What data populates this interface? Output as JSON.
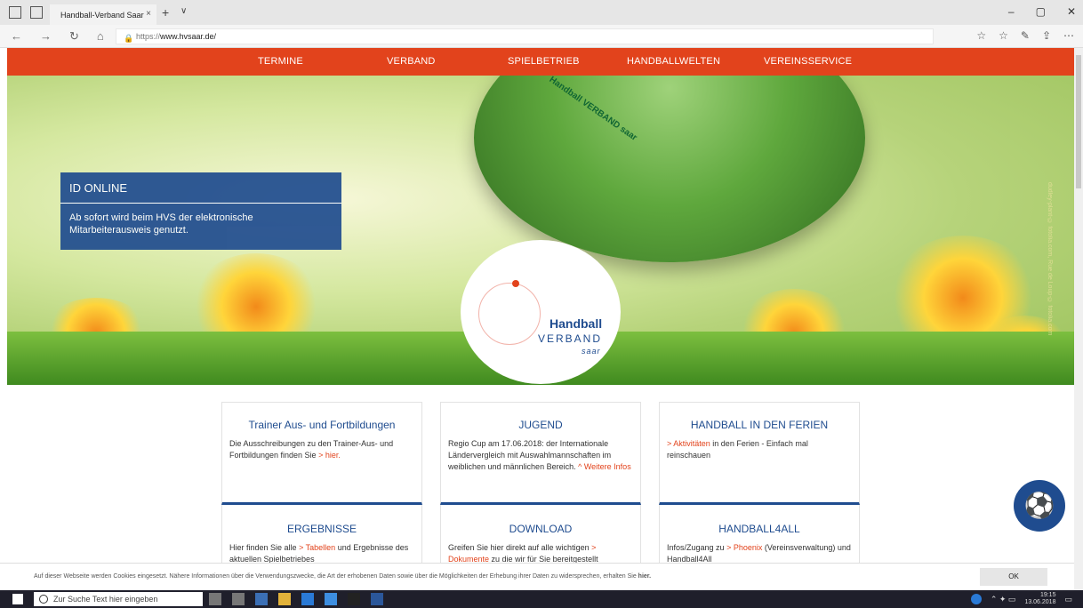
{
  "browser": {
    "tab_title": "Handball-Verband Saar",
    "tab_close": "×",
    "new_tab": "+",
    "tab_menu": "∨",
    "url_prefix": "https://",
    "url_domain": "www.hvsaar.de/",
    "win_controls": [
      "–",
      "▢",
      "✕"
    ],
    "nav_icons": [
      "←",
      "→",
      "↻",
      "⌂"
    ],
    "right_icons": [
      "☆",
      "☆",
      "✎",
      "⇪",
      "⋯"
    ]
  },
  "site": {
    "nav": [
      "TERMINE",
      "VERBAND",
      "SPIELBETRIEB",
      "HANDBALLWELTEN",
      "VEREINSSERVICE"
    ],
    "hero": {
      "info_title": "ID ONLINE",
      "info_text": "Ab sofort wird beim HVS der elektronische Mitarbeiterausweis genutzt.",
      "logo_line1": "Handball",
      "logo_line2": "VERBAND",
      "logo_line3": "saar",
      "ball_text": "Handball VERBAND saar",
      "credit": "dudley-plant-© fotolia.com, Rue de Loup-© fotolia.com"
    },
    "cards": [
      {
        "title": "Trainer Aus- und Fortbildungen",
        "text": "Die Ausschreibungen zu den Trainer-Aus- und Fortbildungen finden Sie",
        "link": "> hier."
      },
      {
        "title": "JUGEND",
        "text": "Regio Cup am 17.06.2018: der Internationale Ländervergleich mit Auswahlmannschaften im weiblichen und männlichen Bereich.",
        "link": "^ Weitere Infos"
      },
      {
        "title": "HANDBALL IN DEN FERIEN",
        "link": "> Aktivitäten",
        "text": "in den Ferien - Einfach mal reinschauen"
      }
    ],
    "cards2": [
      {
        "title": "ERGEBNISSE",
        "text_pre": "Hier finden Sie alle",
        "link": "> Tabellen",
        "text_post": "und Ergebnisse des aktuellen Spielbetriebes"
      },
      {
        "title": "DOWNLOAD",
        "text_pre": "Greifen Sie hier direkt auf alle wichtigen",
        "link": "> Dokumente",
        "text_post": "zu die wir für Sie bereitgestellt"
      },
      {
        "title": "HANDBALL4ALL",
        "text_pre": "Infos/Zugang zu",
        "link": "> Phoenix",
        "text_post": "(Vereinsverwaltung) und Handball4All"
      }
    ],
    "cookie": {
      "text": "Auf dieser Webseite werden Cookies eingesetzt. Nähere Informationen über die Verwendungszwecke, die Art der erhobenen Daten sowie über die Möglichkeiten der Erhebung ihrer Daten zu widersprechen, erhalten Sie",
      "link": "hier.",
      "button": "OK"
    }
  },
  "taskbar": {
    "search_placeholder": "Zur Suche Text hier eingeben",
    "time": "19:15",
    "date": "13.06.2018"
  }
}
